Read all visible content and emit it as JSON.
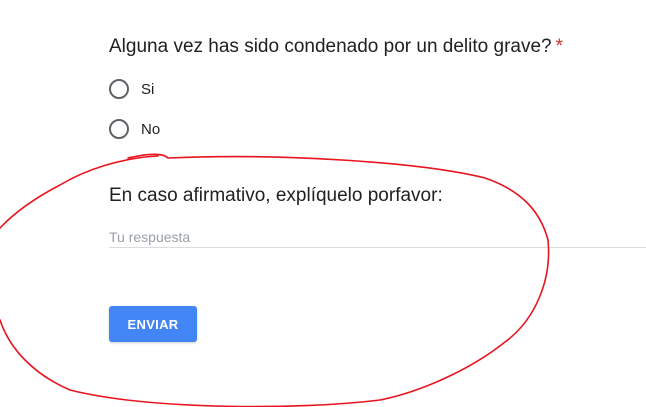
{
  "question1": {
    "title": "Alguna vez has sido condenado por un delito grave?",
    "required_mark": "*",
    "options": [
      {
        "label": "Si",
        "selected": false
      },
      {
        "label": "No",
        "selected": false
      }
    ]
  },
  "question2": {
    "title": "En caso afirmativo, explíquelo porfavor:",
    "input_value": "",
    "input_placeholder": "Tu respuesta"
  },
  "submit": {
    "label": "ENVIAR"
  },
  "colors": {
    "accent": "#4285f4",
    "required": "#d93025",
    "annotation": "#e8141e"
  },
  "annotation": {
    "shape": "hand-drawn red loop around the free-text question and submit button"
  }
}
